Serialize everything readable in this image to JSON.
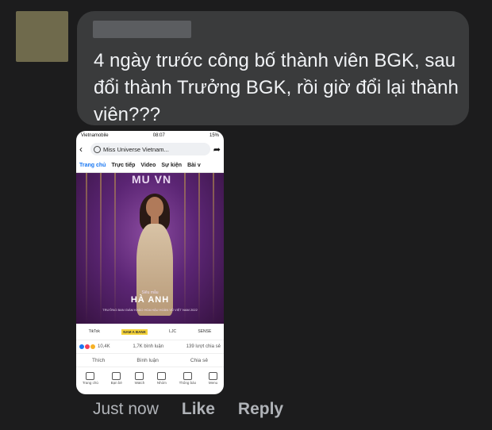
{
  "comment": {
    "text": "4 ngày trước công bố thành viên BGK, sau đổi thành Trưởng BGK, rồi giờ đổi lại thành viên???"
  },
  "screenshot": {
    "status_bar": {
      "carrier": "Vietnamobile",
      "time": "08:07",
      "battery": "15%"
    },
    "search_text": "Miss Universe Vietnam...",
    "tabs": [
      "Trang chủ",
      "Trực tiếp",
      "Video",
      "Sự kiện",
      "Bài v"
    ],
    "poster": {
      "logo": "MU VN",
      "title_small": "Siêu mẫu",
      "name": "HÀ ANH",
      "subtitle": "TRƯỞNG BAN GIÁM KHẢO HOA HẬU HOÀN VŨ VIỆT NAM 2022"
    },
    "sponsors": [
      "TikTok",
      "NAM A BANK",
      "LJC",
      "SENSE"
    ],
    "reactions": {
      "count": "10,4K",
      "comments": "1,7K bình luận",
      "shares": "139 lượt chia sẻ"
    },
    "actions": {
      "like": "Thích",
      "comment": "Bình luận",
      "share": "Chia sẻ"
    },
    "bottom_nav": [
      "Trang chủ",
      "Bạn bè",
      "Watch",
      "Nhóm",
      "Thông báo",
      "Menu"
    ]
  },
  "footer": {
    "time": "Just now",
    "like": "Like",
    "reply": "Reply"
  },
  "colors": {
    "background": "#1c1c1d",
    "bubble": "#3a3b3c",
    "accent": "#1877f2"
  }
}
